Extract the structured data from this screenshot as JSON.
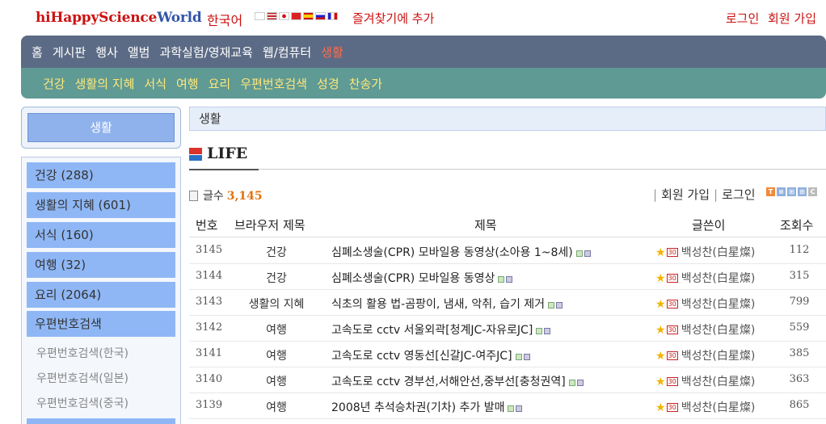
{
  "header": {
    "logo_a": "hiHappyScience",
    "logo_b": "World",
    "language": "한국어",
    "favorites": "즐겨찾기에 추가",
    "login": "로그인",
    "join": "회원 가입"
  },
  "nav": {
    "main": [
      "홈",
      "게시판",
      "행사",
      "앨범",
      "과학실험/영재교육",
      "웹/컴퓨터",
      "생활"
    ],
    "active_index": 6,
    "sub": [
      "건강",
      "생활의 지혜",
      "서식",
      "여행",
      "요리",
      "우편번호검색",
      "성경",
      "찬송가"
    ]
  },
  "sidebar": {
    "title": "생활",
    "items": [
      "건강 (288)",
      "생활의 지혜 (601)",
      "서식 (160)",
      "여행 (32)",
      "요리 (2064)",
      "우편번호검색"
    ],
    "subitems": [
      "우편번호검색(한국)",
      "우편번호검색(일본)",
      "우편번호검색(중국)"
    ]
  },
  "main": {
    "breadcrumb": "생활",
    "section_title": "LIFE",
    "count_label": "글수",
    "count_value": "3,145",
    "member_join": "회원 가입",
    "member_login": "로그인",
    "view_buttons": [
      "T",
      "≡",
      "⊞",
      "⊞",
      "C"
    ],
    "columns": {
      "num": "번호",
      "category": "브라우저 제목",
      "title": "제목",
      "author": "글쓴이",
      "views": "조회수"
    },
    "rows": [
      {
        "num": "3145",
        "category": "건강",
        "title": "심폐소생술(CPR) 모바일용 동영상(소아용 1~8세)",
        "author": "백성찬(白星燦)",
        "views": "112",
        "badge": "30"
      },
      {
        "num": "3144",
        "category": "건강",
        "title": "심폐소생술(CPR) 모바일용 동영상",
        "author": "백성찬(白星燦)",
        "views": "315",
        "badge": "30"
      },
      {
        "num": "3143",
        "category": "생활의 지혜",
        "title": "식초의 활용 법-곰팡이, 냄새, 악취, 습기 제거",
        "author": "백성찬(白星燦)",
        "views": "799",
        "badge": "30"
      },
      {
        "num": "3142",
        "category": "여행",
        "title": "고속도로 cctv 서울외곽[청계JC-자유로JC]",
        "author": "백성찬(白星燦)",
        "views": "559",
        "badge": "30"
      },
      {
        "num": "3141",
        "category": "여행",
        "title": "고속도로 cctv 영동선[신갈JC-여주JC]",
        "author": "백성찬(白星燦)",
        "views": "385",
        "badge": "30"
      },
      {
        "num": "3140",
        "category": "여행",
        "title": "고속도로 cctv 경부선,서해안선,중부선[충청권역]",
        "author": "백성찬(白星燦)",
        "views": "363",
        "badge": "30"
      },
      {
        "num": "3139",
        "category": "여행",
        "title": "2008년 추석승차권(기차) 추가 발매",
        "author": "백성찬(白星燦)",
        "views": "865",
        "badge": "30"
      }
    ]
  },
  "colors": {
    "brand_red": "#cc1111",
    "nav_main_bg": "#5c6b85",
    "nav_sub_bg": "#5f9a94",
    "sidebar_item_bg": "#8fb7f5",
    "count_orange": "#e0730e"
  }
}
